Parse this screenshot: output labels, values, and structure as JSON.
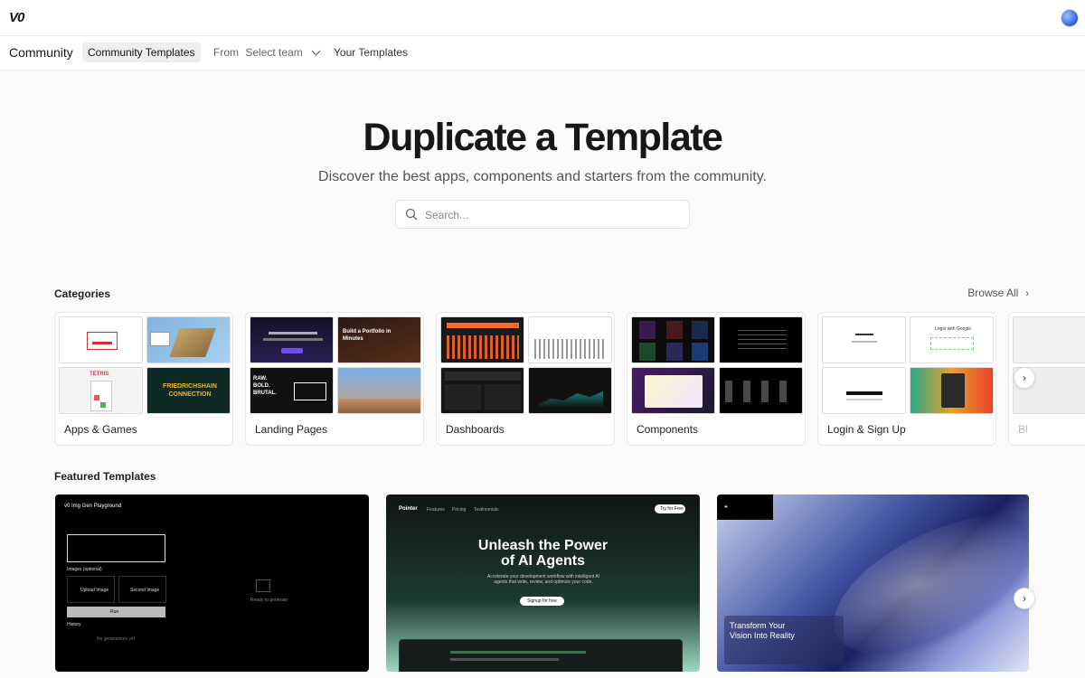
{
  "topbar": {
    "logo": "V0"
  },
  "subnav": {
    "title": "Community",
    "tabs": {
      "community_templates": "Community Templates",
      "from_label": "From",
      "from_value": "Select team",
      "your_templates": "Your Templates"
    }
  },
  "hero": {
    "title": "Duplicate a Template",
    "subtitle": "Discover the best apps, components and starters from the community.",
    "search_placeholder": "Search..."
  },
  "categories": {
    "heading": "Categories",
    "browse_all": "Browse All",
    "items": [
      {
        "label": "Apps & Games"
      },
      {
        "label": "Landing Pages"
      },
      {
        "label": "Dashboards"
      },
      {
        "label": "Components"
      },
      {
        "label": "Login & Sign Up"
      },
      {
        "label": "Bl"
      }
    ],
    "thumb_text": {
      "portfolio": "Build a Portfolio in Minutes",
      "raw": "RAW. BOLD. BRUTAL.",
      "friedrich": "FRIEDRICHSHAIN CONNECTION",
      "tetris": "TETRIS",
      "login": "Login with Google"
    }
  },
  "featured": {
    "heading": "Featured Templates",
    "cards": [
      {
        "app_title": "v0 Img Gen Playground",
        "run": "Run",
        "images": "Images (optional)",
        "history": "History",
        "empty": "No generations yet",
        "ready": "Ready to generate",
        "upload": "Upload Image",
        "second": "Second Image"
      },
      {
        "brand": "Pointer",
        "nav": [
          "Features",
          "Pricing",
          "Testimonials"
        ],
        "cta": "Try for Free",
        "headline_1": "Unleash the Power",
        "headline_2": "of AI Agents",
        "desc": "Accelerate your development workflow with intelligent AI agents that write, review, and optimize your code.",
        "signup": "Signup for free"
      },
      {
        "headline_1": "Transform Your",
        "headline_2": "Vision Into Reality"
      }
    ]
  },
  "colors": {
    "accent": "#171717",
    "muted": "#555555",
    "background": "#fbfbfb"
  }
}
